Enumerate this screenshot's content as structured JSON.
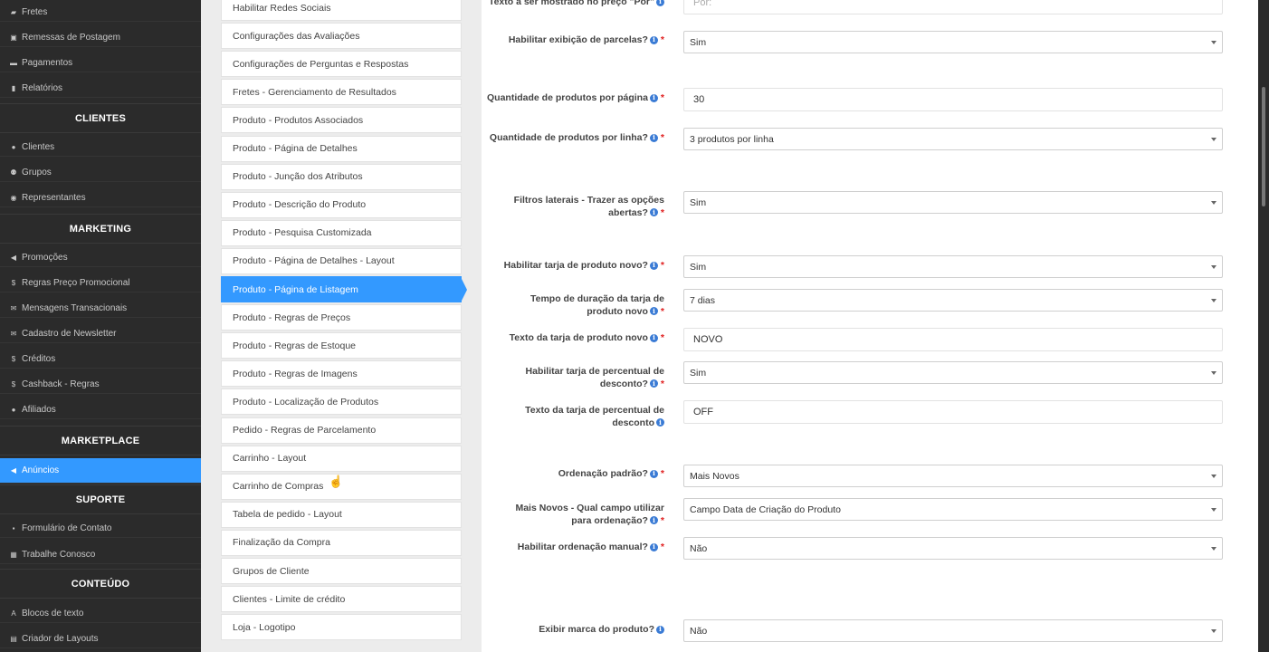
{
  "sidebar": {
    "items_top": [
      {
        "icon": "truck-icon",
        "label": "Fretes"
      },
      {
        "icon": "box-icon",
        "label": "Remessas de Postagem"
      },
      {
        "icon": "credit-card-icon",
        "label": "Pagamentos"
      },
      {
        "icon": "bar-chart-icon",
        "label": "Relatórios"
      }
    ],
    "sections": [
      {
        "title": "CLIENTES",
        "items": [
          {
            "icon": "user-icon",
            "label": "Clientes"
          },
          {
            "icon": "users-icon",
            "label": "Grupos"
          },
          {
            "icon": "user-circle-icon",
            "label": "Representantes"
          }
        ]
      },
      {
        "title": "MARKETING",
        "items": [
          {
            "icon": "megaphone-icon",
            "label": "Promoções"
          },
          {
            "icon": "dollar-icon",
            "label": "Regras Preço Promocional"
          },
          {
            "icon": "envelope-icon",
            "label": "Mensagens Transacionais"
          },
          {
            "icon": "envelope-icon",
            "label": "Cadastro de Newsletter"
          },
          {
            "icon": "dollar-icon",
            "label": "Créditos"
          },
          {
            "icon": "dollar-icon",
            "label": "Cashback - Regras"
          },
          {
            "icon": "user-icon",
            "label": "Afiliados"
          }
        ]
      },
      {
        "title": "MARKETPLACE",
        "items": [
          {
            "icon": "megaphone-icon",
            "label": "Anúncios",
            "active": true
          }
        ]
      },
      {
        "title": "SUPORTE",
        "items": [
          {
            "icon": "comment-icon",
            "label": "Formulário de Contato"
          },
          {
            "icon": "briefcase-icon",
            "label": "Trabalhe Conosco"
          }
        ]
      },
      {
        "title": "CONTEÚDO",
        "items": [
          {
            "icon": "font-icon",
            "label": "Blocos de texto"
          },
          {
            "icon": "layout-icon",
            "label": "Criador de Layouts"
          }
        ]
      }
    ]
  },
  "config_menu": [
    "Habilitar Redes Sociais",
    "Configurações das Avaliações",
    "Configurações de Perguntas e Respostas",
    "Fretes - Gerenciamento de Resultados",
    "Produto - Produtos Associados",
    "Produto - Página de Detalhes",
    "Produto - Junção dos Atributos",
    "Produto - Descrição do Produto",
    "Produto - Pesquisa Customizada",
    "Produto - Página de Detalhes - Layout",
    "Produto - Página de Listagem",
    "Produto - Regras de Preços",
    "Produto - Regras de Estoque",
    "Produto - Regras de Imagens",
    "Produto - Localização de Produtos",
    "Pedido - Regras de Parcelamento",
    "Carrinho - Layout",
    "Carrinho de Compras",
    "Tabela de pedido - Layout",
    "Finalização da Compra",
    "Grupos de Cliente",
    "Clientes - Limite de crédito",
    "Loja - Logotipo"
  ],
  "config_menu_active_index": 10,
  "form": {
    "fields": [
      {
        "label_lines": [
          "Texto a ser mostrado no preço \"Por\""
        ],
        "info": true,
        "required": false,
        "type": "input",
        "value": "",
        "placeholder": "Por:"
      },
      {
        "label_lines": [
          "Habilitar exibição de parcelas?"
        ],
        "info": true,
        "required": true,
        "type": "select",
        "value": "Sim"
      },
      {
        "label_lines": [
          "Quantidade de produtos por página"
        ],
        "info": true,
        "required": true,
        "type": "input",
        "value": "30"
      },
      {
        "label_lines": [
          "Quantidade de produtos por linha?"
        ],
        "info": true,
        "required": true,
        "type": "select",
        "value": "3 produtos por linha"
      },
      {
        "label_lines": [
          "Filtros laterais - Trazer as opções",
          "abertas?"
        ],
        "info": true,
        "required": true,
        "type": "select",
        "value": "Sim"
      },
      {
        "label_lines": [
          "Habilitar tarja de produto novo?"
        ],
        "info": true,
        "required": true,
        "type": "select",
        "value": "Sim"
      },
      {
        "label_lines": [
          "Tempo de duração da tarja de",
          "produto novo"
        ],
        "info": true,
        "required": true,
        "type": "select",
        "value": "7 dias"
      },
      {
        "label_lines": [
          "Texto da tarja de produto novo"
        ],
        "info": true,
        "required": true,
        "type": "input",
        "value": "NOVO"
      },
      {
        "label_lines": [
          "Habilitar tarja de percentual de",
          "desconto?"
        ],
        "info": true,
        "required": true,
        "type": "select",
        "value": "Sim"
      },
      {
        "label_lines": [
          "Texto da tarja de percentual de",
          "desconto"
        ],
        "info": true,
        "required": false,
        "type": "input",
        "value": "OFF"
      },
      {
        "label_lines": [
          "Ordenação padrão?"
        ],
        "info": true,
        "required": true,
        "type": "select",
        "value": "Mais Novos"
      },
      {
        "label_lines": [
          "Mais Novos - Qual campo utilizar",
          "para ordenação?"
        ],
        "info": true,
        "required": true,
        "type": "select",
        "value": "Campo Data de Criação do Produto"
      },
      {
        "label_lines": [
          "Habilitar ordenação manual?"
        ],
        "info": true,
        "required": true,
        "type": "select",
        "value": "Não"
      },
      {
        "label_lines": [
          "Exibir marca do produto?"
        ],
        "info": true,
        "required": false,
        "type": "select",
        "value": "Não"
      }
    ]
  },
  "colors": {
    "accent": "#3399ff",
    "sidebar_bg": "#2b2b2b",
    "required": "#e02020",
    "info": "#3a7bd5"
  }
}
